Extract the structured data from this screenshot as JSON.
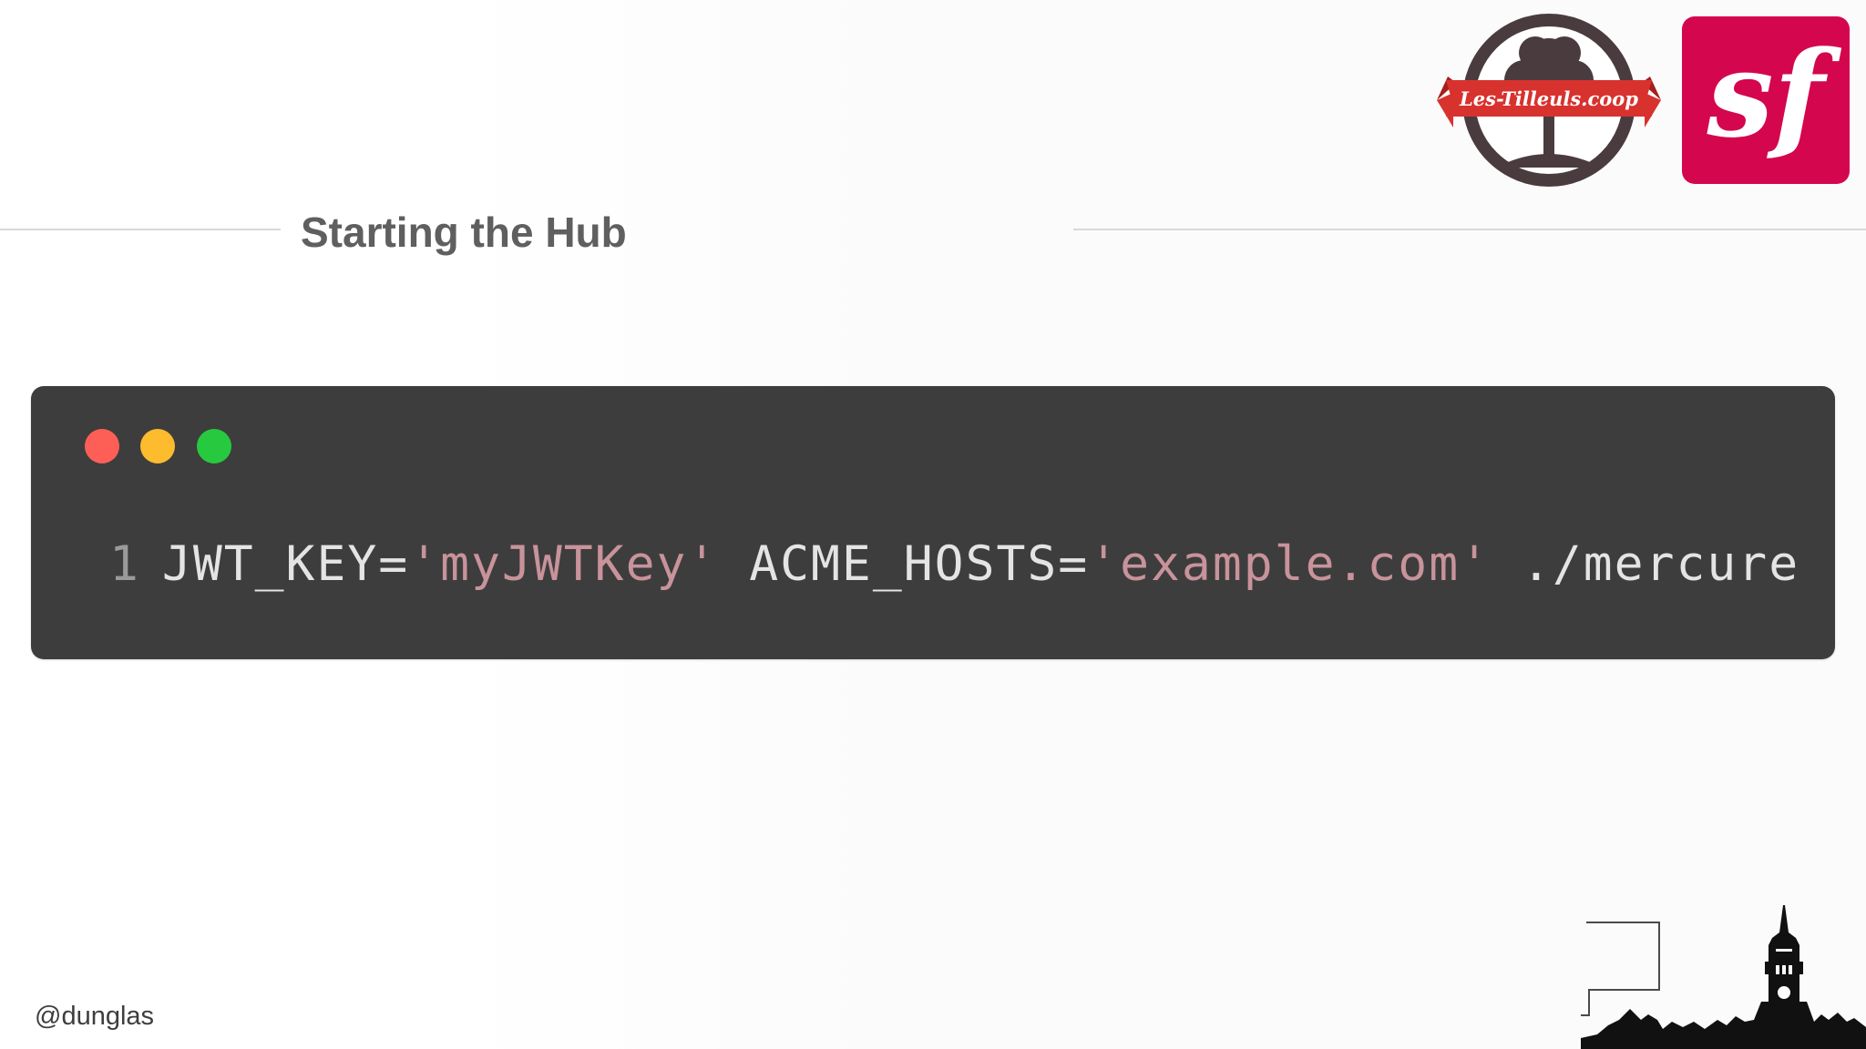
{
  "slide": {
    "title": "Starting the Hub",
    "handle": "@dunglas"
  },
  "logos": {
    "tilleuls_text": "Les-Tilleuls.coop",
    "symfony_glyph": "sf"
  },
  "terminal": {
    "window_controls": [
      "close",
      "minimize",
      "maximize"
    ],
    "line_number": "1",
    "tokens": {
      "t1": "JWT_KEY=",
      "t2": "'myJWTKey'",
      "t3": " ACME_HOSTS=",
      "t4": "'example.com'",
      "t5": " ./mercure"
    }
  },
  "colors": {
    "symfony_brand": "#d4064d",
    "tilleuls_ribbon": "#d8322e",
    "tilleuls_ring": "#4a3b3f",
    "terminal_bg": "#3d3d3d",
    "string_color": "#c8939b"
  }
}
